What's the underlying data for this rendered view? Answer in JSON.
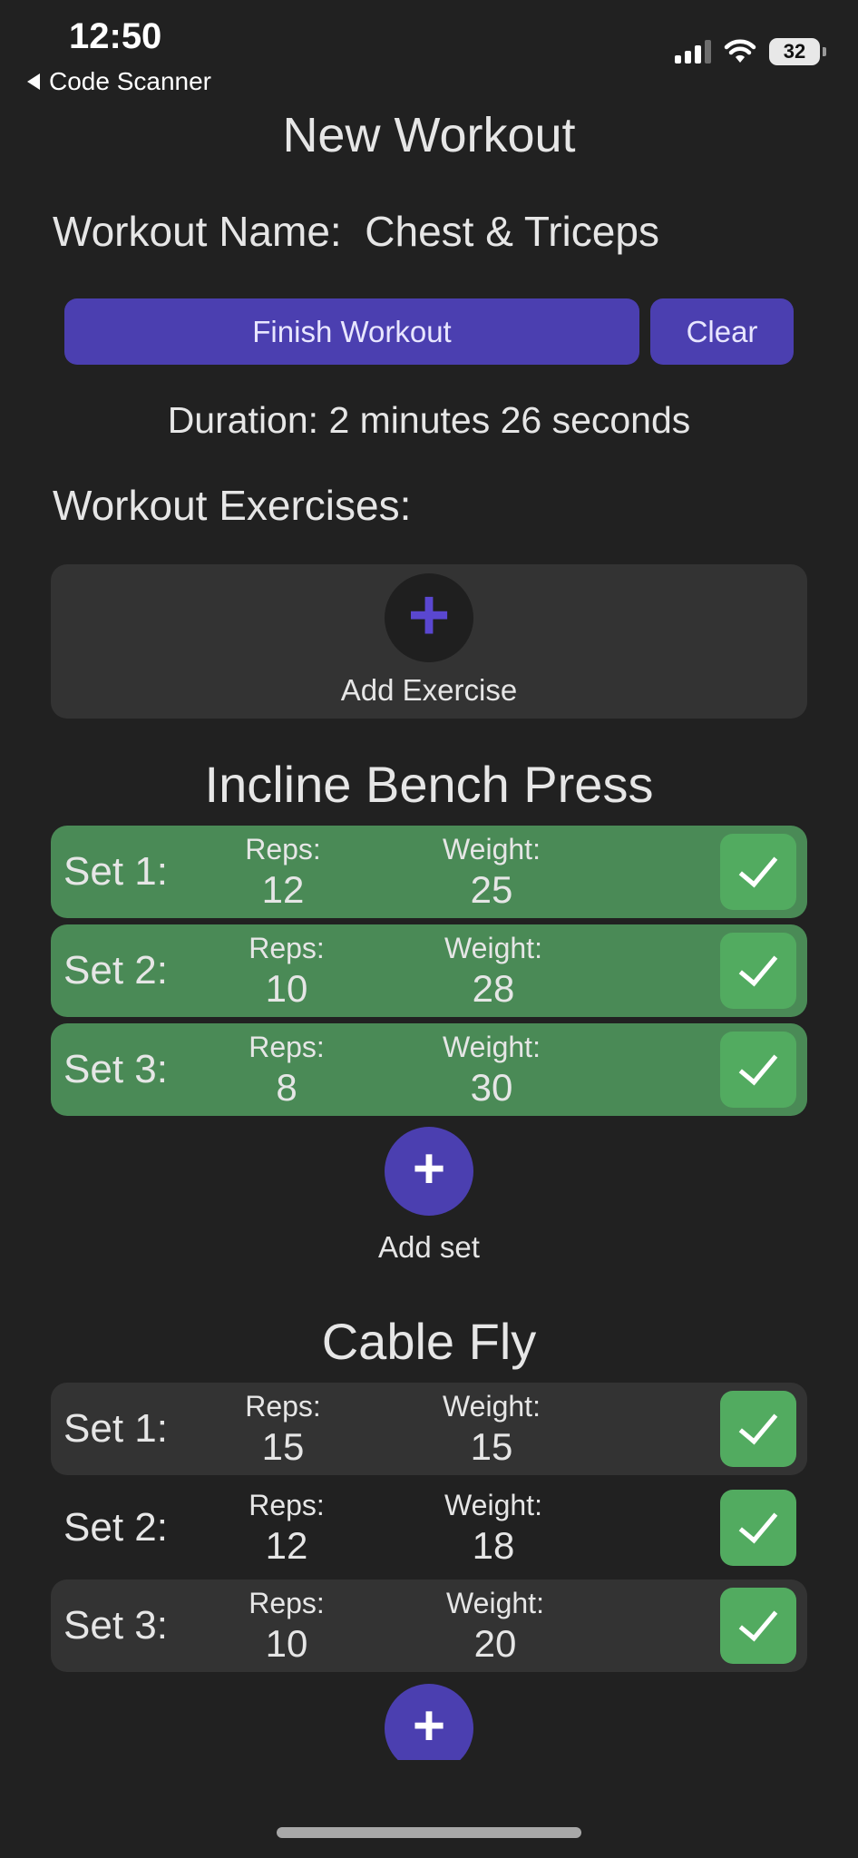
{
  "status_bar": {
    "time": "12:50",
    "back_label": "Code Scanner",
    "battery": "32"
  },
  "header": {
    "title": "New Workout"
  },
  "workout": {
    "name_label": "Workout Name:",
    "name_value": "Chest & Triceps",
    "finish_label": "Finish Workout",
    "clear_label": "Clear",
    "duration": "Duration: 2 minutes 26 seconds",
    "exercises_label": "Workout Exercises:",
    "add_exercise_label": "Add Exercise"
  },
  "exercises": [
    {
      "name": "Incline Bench Press",
      "add_set_label": "Add set",
      "sets": [
        {
          "label": "Set 1:",
          "reps_caption": "Reps:",
          "reps": "12",
          "weight_caption": "Weight:",
          "weight": "25",
          "completed": true
        },
        {
          "label": "Set 2:",
          "reps_caption": "Reps:",
          "reps": "10",
          "weight_caption": "Weight:",
          "weight": "28",
          "completed": true
        },
        {
          "label": "Set 3:",
          "reps_caption": "Reps:",
          "reps": "8",
          "weight_caption": "Weight:",
          "weight": "30",
          "completed": true
        }
      ]
    },
    {
      "name": "Cable Fly",
      "sets": [
        {
          "label": "Set 1:",
          "reps_caption": "Reps:",
          "reps": "15",
          "weight_caption": "Weight:",
          "weight": "15",
          "completed": true
        },
        {
          "label": "Set 2:",
          "reps_caption": "Reps:",
          "reps": "12",
          "weight_caption": "Weight:",
          "weight": "18",
          "completed": true
        },
        {
          "label": "Set 3:",
          "reps_caption": "Reps:",
          "reps": "10",
          "weight_caption": "Weight:",
          "weight": "20",
          "completed": true
        }
      ]
    }
  ],
  "colors": {
    "accent": "#4b3fb0",
    "completed_row": "#4a8a56",
    "check": "#52ab60",
    "background": "#212121"
  },
  "icons": {
    "back": "back-triangle-icon",
    "signal": "cellular-signal-icon",
    "wifi": "wifi-icon",
    "battery": "battery-icon",
    "add": "plus-icon",
    "done": "checkmark-icon"
  }
}
